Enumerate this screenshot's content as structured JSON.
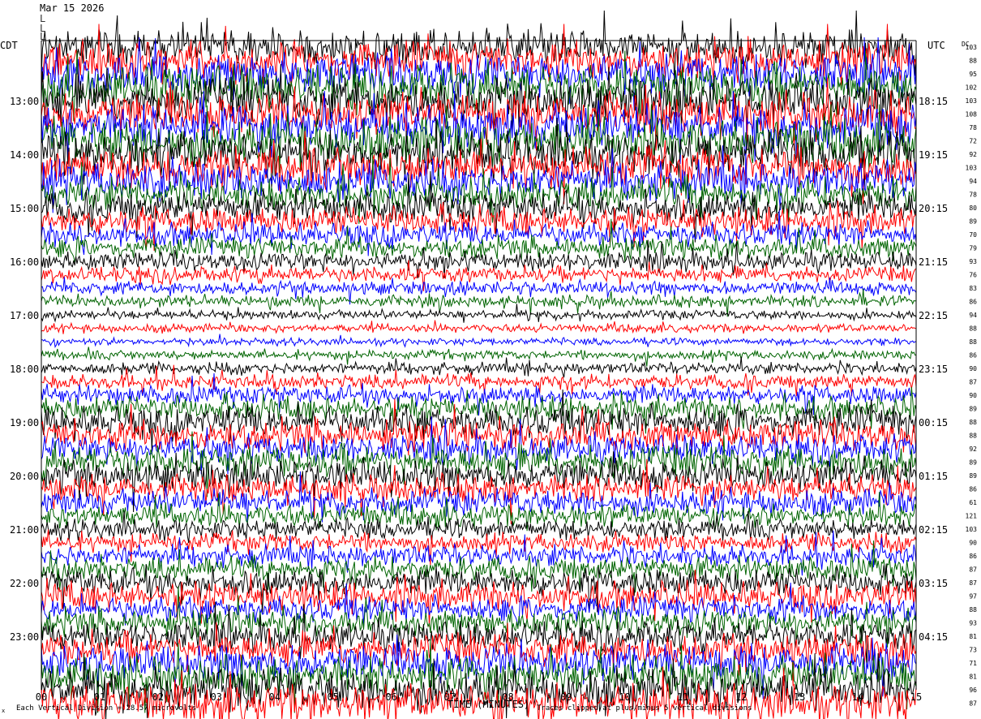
{
  "header": {
    "date": "Mar 15 2026",
    "line2": "L",
    "line3": "L",
    "line4": "L"
  },
  "left_timezone": "CDT",
  "right_timezone": "UTC",
  "dc_label": "DC",
  "footer": {
    "corner": "x",
    "division": "Each Vertical Division =   28.57 microvolts",
    "xlabel": "TIME (MINUTES)",
    "clip": "Traces clipped at plus/minus 5 vertical divisions"
  },
  "chart_data": {
    "type": "line",
    "subtype": "helicorder",
    "xlabel": "TIME (MINUTES)",
    "x_ticks": [
      "00",
      "01",
      "02",
      "03",
      "04",
      "05",
      "06",
      "07",
      "08",
      "09",
      "10",
      "11",
      "12",
      "13",
      "14",
      "15"
    ],
    "xlim": [
      0,
      15
    ],
    "left_hour_labels": [
      "13:00",
      "14:00",
      "15:00",
      "16:00",
      "17:00",
      "18:00",
      "19:00",
      "20:00",
      "21:00",
      "22:00",
      "23:00"
    ],
    "right_hour_labels": [
      "18:15",
      "19:15",
      "20:15",
      "21:15",
      "22:15",
      "23:15",
      "00:15",
      "01:15",
      "02:15",
      "03:15",
      "04:15"
    ],
    "dc_values": [
      103,
      88,
      95,
      102,
      103,
      108,
      78,
      72,
      92,
      103,
      94,
      78,
      80,
      89,
      70,
      79,
      93,
      76,
      83,
      86,
      94,
      88,
      88,
      86,
      90,
      87,
      90,
      89,
      88,
      88,
      92,
      89,
      89,
      86,
      61,
      121,
      103,
      90,
      86,
      87,
      87,
      97,
      88,
      93,
      81,
      73,
      71,
      81,
      96,
      87
    ],
    "trace_colors": [
      "#000000",
      "#ff0000",
      "#0000ff",
      "#006400"
    ],
    "traces_per_hour": 4,
    "trace_amplitude": [
      4.0,
      4.2,
      4.5,
      4.8,
      5.0,
      4.6,
      4.8,
      5.0,
      5.0,
      4.5,
      4.2,
      3.6,
      3.4,
      3.0,
      2.6,
      2.3,
      2.0,
      1.7,
      1.5,
      1.3,
      1.0,
      0.9,
      0.8,
      1.0,
      1.3,
      1.6,
      2.0,
      2.6,
      3.5,
      3.3,
      3.0,
      3.6,
      3.4,
      3.0,
      2.8,
      2.5,
      2.2,
      2.0,
      2.4,
      2.6,
      3.0,
      3.2,
      2.8,
      2.9,
      3.2,
      3.6,
      4.0,
      4.2,
      4.4,
      4.3
    ],
    "clip_divisions": 5,
    "grid": false
  }
}
